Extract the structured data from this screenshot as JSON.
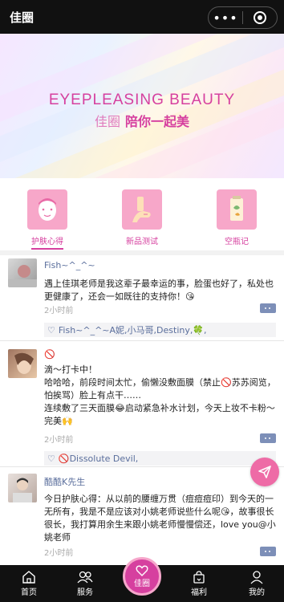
{
  "header": {
    "title": "佳圈",
    "more_glyph": "•••"
  },
  "banner": {
    "headline_en": "EYEPLEASING BEAUTY",
    "brand_cn": "佳圈",
    "slogan_cn": "陪你一起美"
  },
  "tabs": [
    {
      "label": "护肤心得",
      "icon": "face-mask-icon",
      "active": true
    },
    {
      "label": "新品测试",
      "icon": "hand-cream-icon",
      "active": false
    },
    {
      "label": "空瓶记",
      "icon": "empty-bottle-icon",
      "active": false
    }
  ],
  "posts": [
    {
      "user": "Fish~^_^~",
      "text": "遇上佳琪老师是我这辈子最幸运的事，脸蛋也好了，私处也更健康了，还会一如既往的支持你！😘",
      "time": "2小时前",
      "likes": "Fish~^_^~A妮,小马哥,Destiny,🍀,"
    },
    {
      "user": "🚫",
      "text": "滴～打卡中！\n哈哈哈，前段时间太忙，偷懒没敷面膜（禁止🚫苏苏阅览，怕挨骂）脸上有点干……\n连续敷了三天面膜😂启动紧急补水计划，今天上妆不卡粉～完美🙌",
      "time": "2小时前",
      "likes": "🚫Dissolute Devil,"
    },
    {
      "user": "酷酷K先生",
      "text": "今日护肤心得：从以前的腰缠万贯（痘痘痘印）到今天的一无所有，我是不是应该对小姚老师说些什么呢😘，故事很长很长，我打算用余生来跟小姚老师慢慢偿还，love you@小姚老师",
      "time": "2小时前"
    }
  ],
  "bottom_nav": [
    {
      "label": "首页",
      "icon": "home-icon"
    },
    {
      "label": "服务",
      "icon": "service-icon"
    },
    {
      "label": "佳圈",
      "icon": "heart-icon",
      "center": true
    },
    {
      "label": "福利",
      "icon": "gift-bag-icon"
    },
    {
      "label": "我的",
      "icon": "user-icon"
    }
  ],
  "colors": {
    "accent": "#d6409f",
    "tab_icon_bg": "#f7a7c9",
    "username": "#5a6e9c",
    "bar_bg": "#111111"
  }
}
